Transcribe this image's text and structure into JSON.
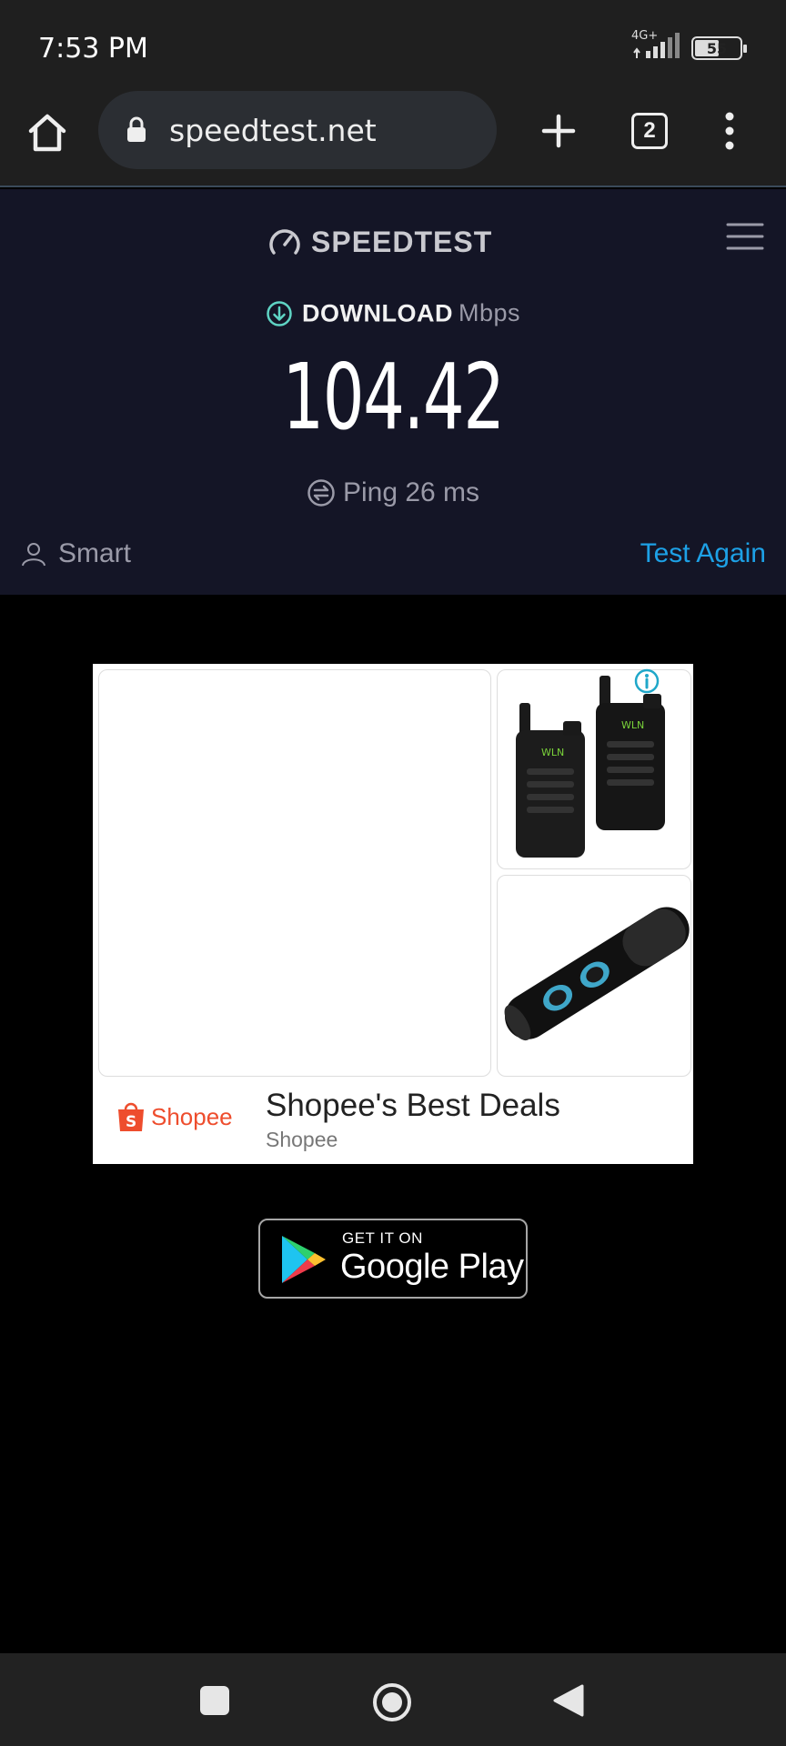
{
  "status_bar": {
    "time": "7:53 PM",
    "network": "4G+",
    "battery": "55"
  },
  "browser": {
    "url": "speedtest.net",
    "tab_count": "2"
  },
  "speedtest": {
    "logo": "SPEEDTEST",
    "download_label": "DOWNLOAD",
    "download_unit": "Mbps",
    "download_value": "104.42",
    "ping_text": "Ping 26 ms",
    "provider_label": "Smart",
    "test_again_label": "Test Again"
  },
  "ad": {
    "brand": "Shopee",
    "title": "Shopee's Best Deals",
    "subtitle": "Shopee"
  },
  "store_badge": {
    "small": "GET IT ON",
    "big": "Google Play"
  },
  "colors": {
    "accent": "#1da1e6",
    "hero_bg": "#141526",
    "shopee": "#ee4d2d"
  }
}
